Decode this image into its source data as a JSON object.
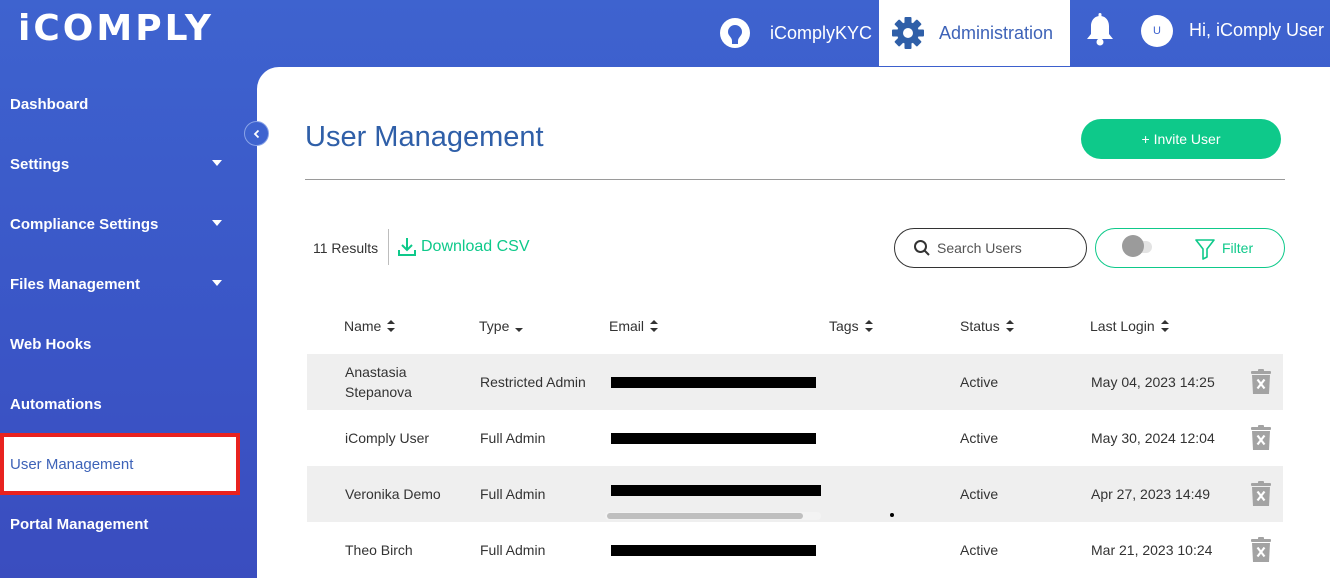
{
  "header": {
    "logo": "iCOMPLY",
    "nav_kyc": "iComplyKYC",
    "nav_admin": "Administration",
    "avatar_initial": "U",
    "greeting": "Hi, iComply User"
  },
  "sidebar": {
    "items": [
      {
        "label": "Dashboard",
        "has_caret": false
      },
      {
        "label": "Settings",
        "has_caret": true
      },
      {
        "label": "Compliance Settings",
        "has_caret": true
      },
      {
        "label": "Files Management",
        "has_caret": true
      },
      {
        "label": "Web Hooks",
        "has_caret": false
      },
      {
        "label": "Automations",
        "has_caret": false
      },
      {
        "label": "User Management",
        "has_caret": false,
        "active": true
      },
      {
        "label": "Portal Management",
        "has_caret": false
      }
    ]
  },
  "main": {
    "title": "User Management",
    "invite_label": "+ Invite User",
    "results": "11 Results",
    "download_label": "Download CSV",
    "search_placeholder": "Search Users",
    "filter_label": "Filter",
    "columns": [
      "Name",
      "Type",
      "Email",
      "Tags",
      "Status",
      "Last Login"
    ],
    "rows": [
      {
        "name": "Anastasia Stepanova",
        "type": "Restricted Admin",
        "email": "",
        "tags": "",
        "status": "Active",
        "last_login": "May 04, 2023 14:25"
      },
      {
        "name": "iComply User",
        "type": "Full Admin",
        "email": "",
        "tags": "",
        "status": "Active",
        "last_login": "May 30, 2024 12:04"
      },
      {
        "name": "Veronika Demo",
        "type": "Full Admin",
        "email": "",
        "tags": "",
        "status": "Active",
        "last_login": "Apr 27, 2023 14:49"
      },
      {
        "name": "Theo Birch",
        "type": "Full Admin",
        "email": "",
        "tags": "",
        "status": "Active",
        "last_login": "Mar 21, 2023 10:24"
      }
    ]
  },
  "colors": {
    "brand_blue": "#3e63cf",
    "accent_green": "#0ec98a",
    "highlight_red": "#e8221f"
  }
}
